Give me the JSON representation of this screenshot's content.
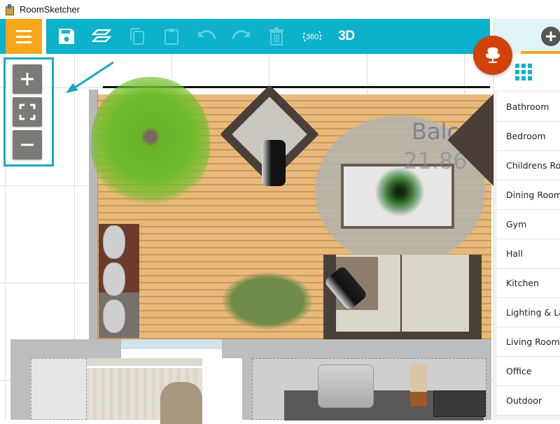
{
  "window": {
    "title": "RoomSketcher"
  },
  "toolbar": {
    "menu": "menu-icon",
    "buttons": [
      {
        "name": "save",
        "icon": "save-icon",
        "enabled": true
      },
      {
        "name": "floors",
        "icon": "layers-icon",
        "enabled": true
      },
      {
        "name": "copy",
        "icon": "copy-icon",
        "enabled": false
      },
      {
        "name": "paste",
        "icon": "paste-icon",
        "enabled": false
      },
      {
        "name": "undo",
        "icon": "undo-icon",
        "enabled": false
      },
      {
        "name": "redo",
        "icon": "redo-icon",
        "enabled": false
      },
      {
        "name": "delete",
        "icon": "trash-icon",
        "enabled": false
      },
      {
        "name": "view-360",
        "label": "360",
        "enabled": true
      },
      {
        "name": "view-3d",
        "label": "3D",
        "enabled": true
      }
    ],
    "accent_color": "#0cb1cb",
    "menu_color": "#f8a51c"
  },
  "zoom_controls": {
    "zoom_in": "plus-icon",
    "fit": "fullscreen-icon",
    "zoom_out": "minus-icon"
  },
  "floorplan": {
    "room_label": "Balco",
    "room_area": "21.86"
  },
  "fab": {
    "icon": "armchair-icon",
    "color": "#d2430c"
  },
  "sidebar": {
    "tabs": [
      {
        "icon": "add-icon",
        "active": true
      },
      {
        "icon": "grid-icon"
      }
    ],
    "categories": [
      {
        "label": "Bathroom"
      },
      {
        "label": "Bedroom"
      },
      {
        "label": "Childrens Room"
      },
      {
        "label": "Dining Room"
      },
      {
        "label": "Gym"
      },
      {
        "label": "Hall"
      },
      {
        "label": "Kitchen"
      },
      {
        "label": "Lighting & Lamps"
      },
      {
        "label": "Living Room"
      },
      {
        "label": "Office"
      },
      {
        "label": "Outdoor"
      }
    ]
  }
}
